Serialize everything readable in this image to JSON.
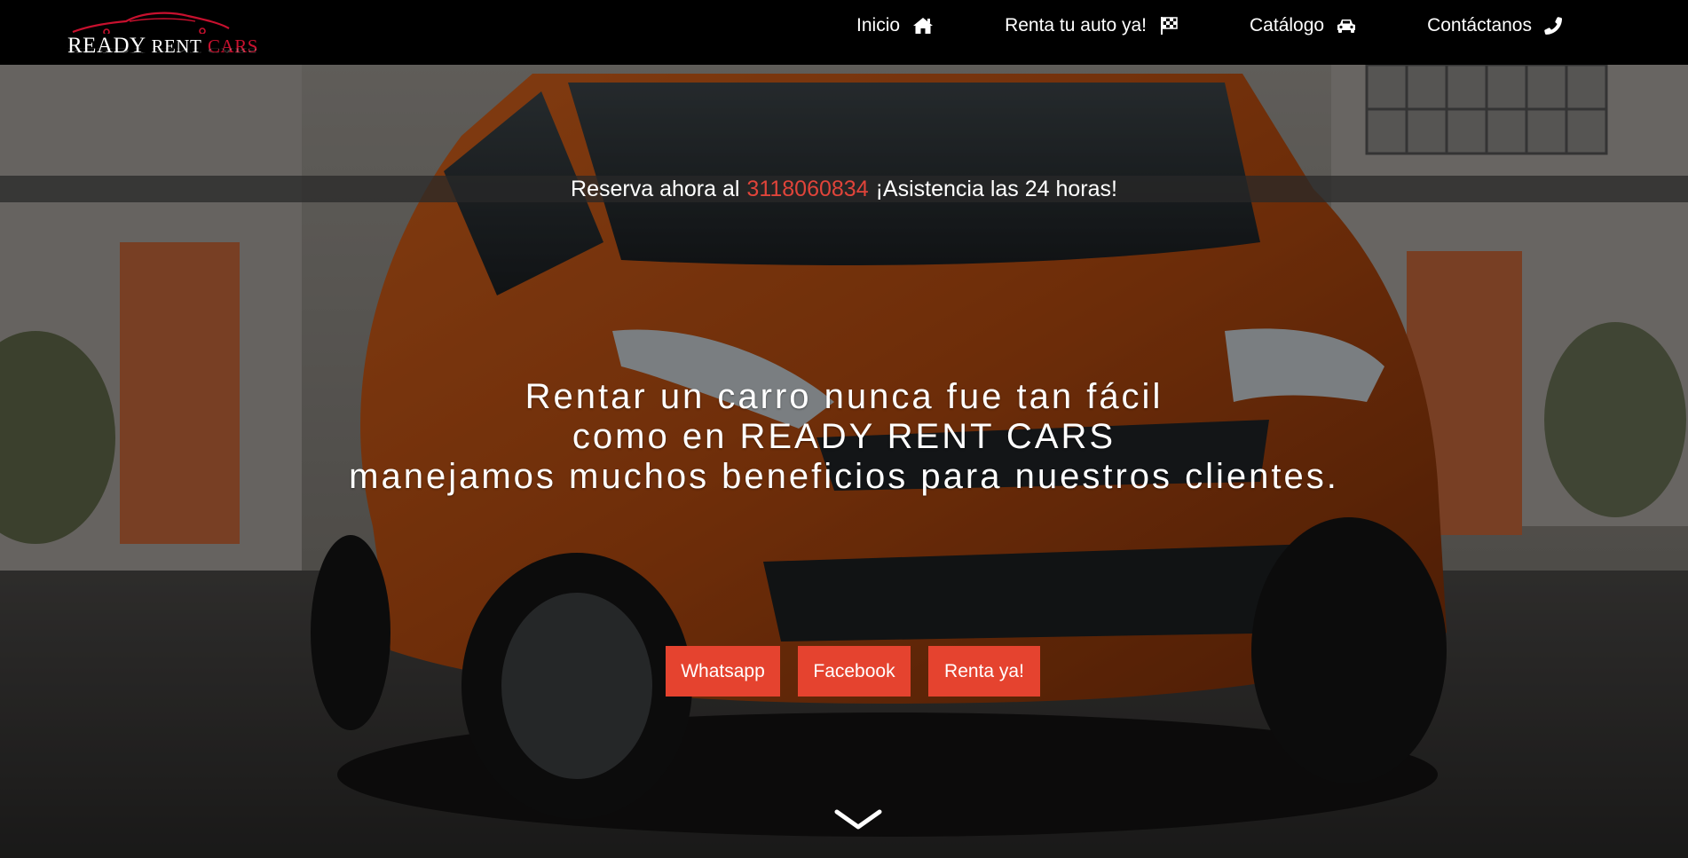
{
  "brand": {
    "logo_word_1": "READY",
    "logo_word_2": "RENT",
    "logo_word_3": "CARS",
    "accent_color": "#c8102e"
  },
  "nav": {
    "items": [
      {
        "label": "Inicio",
        "icon": "home-icon"
      },
      {
        "label": "Renta tu auto ya!",
        "icon": "checkered-flag-icon"
      },
      {
        "label": "Catálogo",
        "icon": "car-icon"
      },
      {
        "label": "Contáctanos",
        "icon": "phone-icon"
      }
    ]
  },
  "banner": {
    "prefix": "Reserva ahora al",
    "phone": "3118060834",
    "suffix": "¡Asistencia las 24 horas!",
    "phone_color": "#e0443a"
  },
  "hero": {
    "lines": [
      "Rentar un carro nunca fue tan fácil",
      "como en READY RENT CARS",
      "manejamos muchos beneficios para nuestros clientes."
    ],
    "background_icon": "orange-car-photo"
  },
  "cta": {
    "whatsapp": "Whatsapp",
    "facebook": "Facebook",
    "renta": "Renta ya!",
    "button_color": "#e5432f"
  },
  "scroll": {
    "icon": "chevron-down-icon"
  }
}
